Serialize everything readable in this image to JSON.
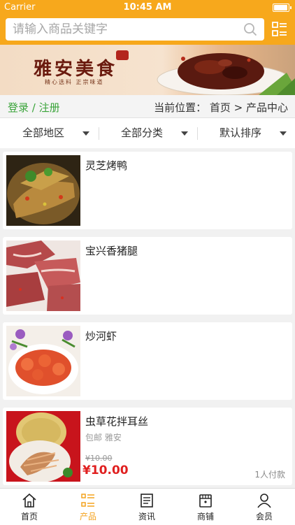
{
  "status": {
    "carrier": "Carrier",
    "time": "10:45 AM"
  },
  "search": {
    "placeholder": "请输入商品关键字"
  },
  "banner": {
    "title": "雅安美食",
    "subtitle": "精心选料  正宗味道"
  },
  "crumbs": {
    "login": "登录 / 注册",
    "location": "当前位置： 首页 > 产品中心"
  },
  "filters": [
    "全部地区",
    "全部分类",
    "默认排序"
  ],
  "products": [
    {
      "name": "灵芝烤鸭"
    },
    {
      "name": "宝兴香猪腿"
    },
    {
      "name": "炒河虾"
    },
    {
      "name": "虫草花拌耳丝",
      "tag": "包邮 雅安",
      "old_price": "¥10.00",
      "price": "¥10.00",
      "paid": "1人付款"
    }
  ],
  "tabs": [
    {
      "label": "首页",
      "icon": "home-icon",
      "active": false
    },
    {
      "label": "产品",
      "icon": "list-icon",
      "active": true
    },
    {
      "label": "资讯",
      "icon": "news-icon",
      "active": false
    },
    {
      "label": "商铺",
      "icon": "shop-icon",
      "active": false
    },
    {
      "label": "会员",
      "icon": "user-icon",
      "active": false
    }
  ],
  "colors": {
    "accent": "#f7a81c",
    "price": "#e02020",
    "login": "#3aa43a"
  }
}
